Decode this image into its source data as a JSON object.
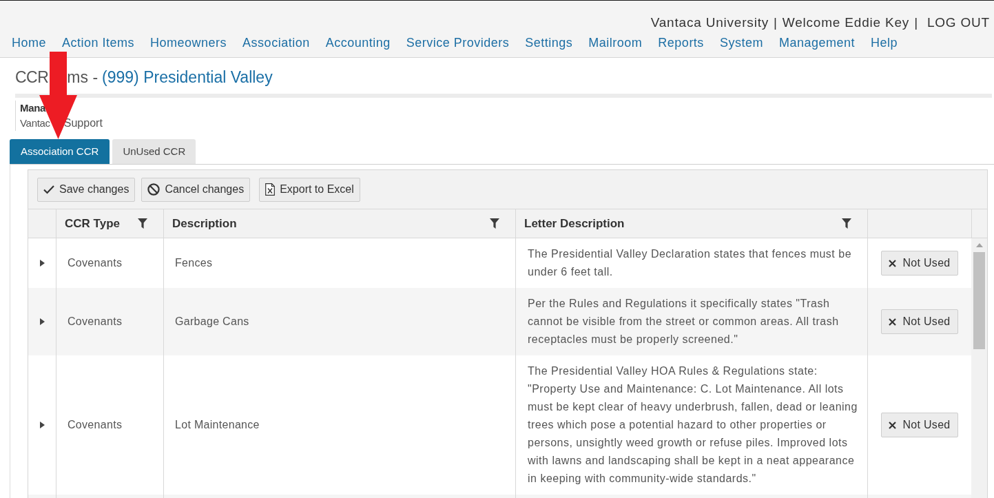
{
  "user_bar": {
    "items": [
      {
        "kind": "text",
        "text": "Vantaca University"
      },
      {
        "kind": "separator",
        "text": "|"
      },
      {
        "kind": "text",
        "text": "Welcome Eddie Key"
      },
      {
        "kind": "separator",
        "text": "|"
      },
      {
        "kind": "link",
        "text": "LOG OUT"
      }
    ]
  },
  "nav": {
    "items": [
      "Home",
      "Action Items",
      "Homeowners",
      "Association",
      "Accounting",
      "Service Providers",
      "Settings",
      "Mailroom",
      "Reports",
      "System",
      "Management",
      "Help"
    ]
  },
  "page_title": {
    "parts": [
      "CCR",
      "ms -"
    ],
    "association_link": "(999) Presidential Valley"
  },
  "manager": {
    "label": "Mana",
    "value_parts": [
      "Vantac",
      "Support"
    ]
  },
  "tabs": [
    {
      "label": "Association CCR",
      "selected": true
    },
    {
      "label": "UnUsed CCR",
      "selected": false
    }
  ],
  "toolbar": {
    "buttons": [
      {
        "kind": "save",
        "label": "Save changes"
      },
      {
        "kind": "cancel",
        "label": "Cancel changes"
      },
      {
        "kind": "export",
        "label": "Export to Excel"
      }
    ]
  },
  "table": {
    "columns": [
      {
        "label": "CCR Type",
        "filter": true
      },
      {
        "label": "Description",
        "filter": true
      },
      {
        "label": "Letter Description",
        "filter": true
      }
    ],
    "rows": [
      {
        "expanded": false,
        "ccr_type": "Covenants",
        "description": "Fences",
        "letter_description": "The Presidential Valley Declaration states that fences must be under 6 feet tall.",
        "action": "Not Used"
      },
      {
        "expanded": false,
        "ccr_type": "Covenants",
        "description": "Garbage Cans",
        "letter_description": "Per the Rules and Regulations it specifically states \"Trash cannot be visible from the street or common areas. All trash receptacles must be properly screened.\"",
        "action": "Not Used"
      },
      {
        "expanded": false,
        "ccr_type": "Covenants",
        "description": "Lot Maintenance",
        "letter_description": "The Presidential Valley HOA Rules & Regulations state: \"Property Use and Maintenance: C. Lot Maintenance. All lots must be kept clear of heavy underbrush, fallen, dead or leaning trees which pose a potential hazard to other properties or persons, unsightly weed growth or refuse piles. Improved lots with lawns and landscaping shall be kept in a neat appearance in keeping with community-wide standards.\"",
        "action": "Not Used"
      }
    ]
  }
}
